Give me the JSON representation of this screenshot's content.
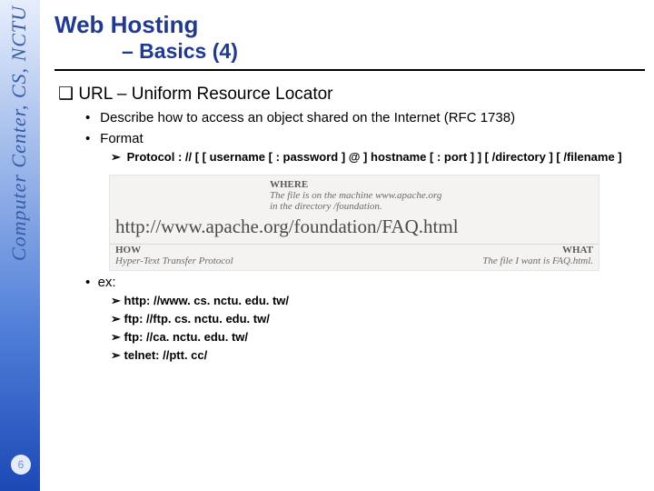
{
  "side_label": "Computer Center, CS, NCTU",
  "page_number": "6",
  "title": {
    "line1": "Web Hosting",
    "line2": "– Basics (4)"
  },
  "h1": "URL – Uniform Resource Locator",
  "b1": "Describe how to access an object shared on the Internet (RFC 1738)",
  "b2": "Format",
  "fmt": "Protocol : // [ [ username [ : password ] @ ] hostname [ : port ] ] [ /directory ] [ /filename ]",
  "figure": {
    "where_label": "WHERE",
    "where_text1": "The file is on the machine www.apache.org",
    "where_text2": "in the directory /foundation.",
    "url": "http://www.apache.org/foundation/FAQ.html",
    "how_label": "HOW",
    "how_text": "Hyper-Text Transfer Protocol",
    "what_label": "WHAT",
    "what_text": "The file I want is FAQ.html."
  },
  "ex_label": "ex:",
  "examples": {
    "e1": "http: //www. cs. nctu. edu. tw/",
    "e2": "ftp: //ftp. cs. nctu. edu. tw/",
    "e3": "ftp: //ca. nctu. edu. tw/",
    "e4": "telnet: //ptt. cc/"
  }
}
